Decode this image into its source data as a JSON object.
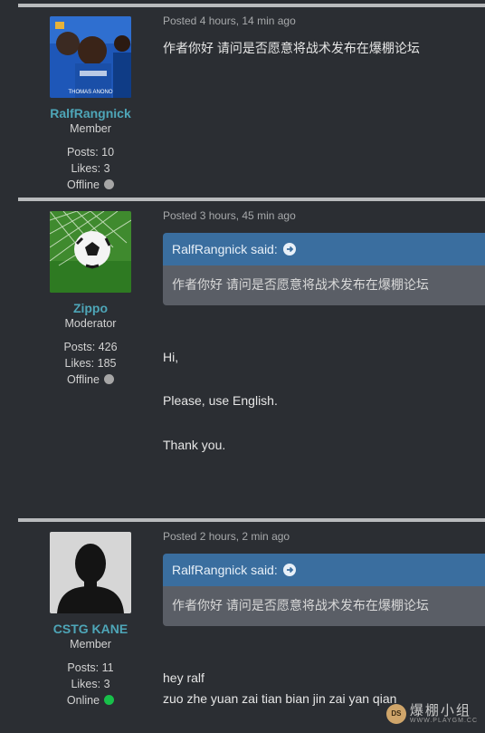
{
  "posts": [
    {
      "username": "RalfRangnick",
      "role": "Member",
      "posts_label": "Posts: 10",
      "likes_label": "Likes: 3",
      "status": "Offline",
      "online": false,
      "avatar_caption": "THOMAS ANONO",
      "posted": "Posted 4 hours, 14 min ago",
      "message": "作者你好 请问是否愿意将战术发布在爆棚论坛"
    },
    {
      "username": "Zippo",
      "role": "Moderator",
      "posts_label": "Posts: 426",
      "likes_label": "Likes: 185",
      "status": "Offline",
      "online": false,
      "posted": "Posted 3 hours, 45 min ago",
      "quote_author": "RalfRangnick said:",
      "quote_text": "作者你好 请问是否愿意将战术发布在爆棚论坛",
      "lines": [
        "Hi,",
        "Please, use English.",
        "Thank you."
      ]
    },
    {
      "username": "CSTG KANE",
      "role": "Member",
      "posts_label": "Posts: 11",
      "likes_label": "Likes: 3",
      "status": "Online",
      "online": true,
      "posted": "Posted 2 hours, 2 min ago",
      "quote_author": "RalfRangnick said:",
      "quote_text": "作者你好 请问是否愿意将战术发布在爆棚论坛",
      "lines": [
        "hey ralf",
        "zuo zhe yuan zai tian bian jin zai yan qian"
      ]
    }
  ],
  "watermark": {
    "text": "爆棚小组",
    "url": "WWW.PLAYGM.CC"
  },
  "colors": {
    "background": "#2b2e33",
    "username": "#4ea6b8",
    "quote_header": "#3a6e9f",
    "quote_body": "#5a5e66",
    "online": "#18c04a",
    "offline": "#a6a6a6"
  }
}
